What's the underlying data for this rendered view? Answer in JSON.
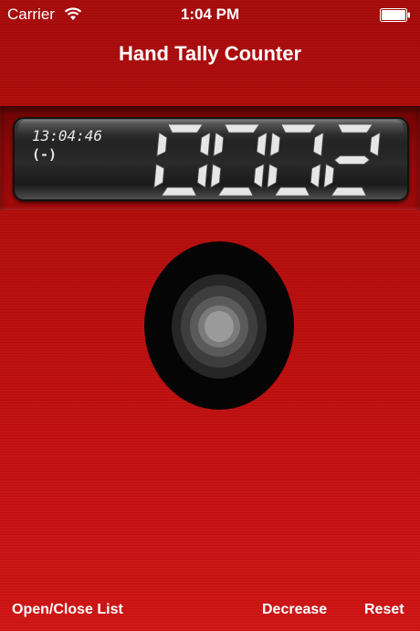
{
  "status_bar": {
    "carrier": "Carrier",
    "time": "1:04 PM",
    "wifi_icon": "wifi-icon",
    "battery_icon": "battery-icon"
  },
  "nav": {
    "title": "Hand Tally Counter"
  },
  "display": {
    "timestamp": "13:04:46",
    "sign": "(-)",
    "count": "0002"
  },
  "toolbar": {
    "open_close_list": "Open/Close List",
    "decrease": "Decrease",
    "reset": "Reset"
  },
  "colors": {
    "background": "#b50d0d",
    "digit": "#e6e6e6",
    "text": "#ffffff"
  }
}
